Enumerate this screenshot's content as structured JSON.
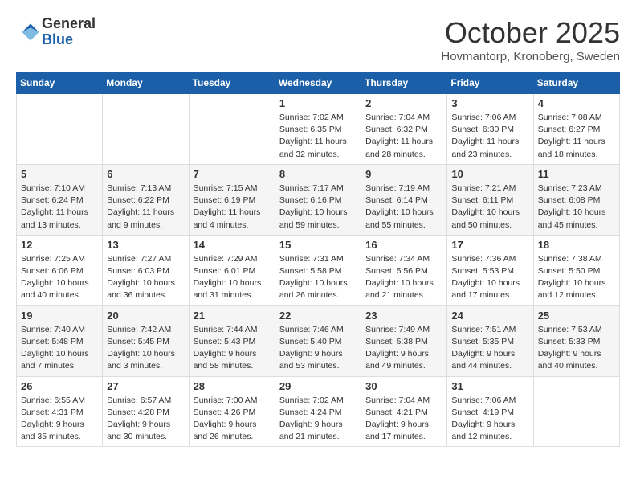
{
  "header": {
    "logo_general": "General",
    "logo_blue": "Blue",
    "month_title": "October 2025",
    "location": "Hovmantorp, Kronoberg, Sweden"
  },
  "weekdays": [
    "Sunday",
    "Monday",
    "Tuesday",
    "Wednesday",
    "Thursday",
    "Friday",
    "Saturday"
  ],
  "weeks": [
    [
      {
        "day": "",
        "info": ""
      },
      {
        "day": "",
        "info": ""
      },
      {
        "day": "",
        "info": ""
      },
      {
        "day": "1",
        "info": "Sunrise: 7:02 AM\nSunset: 6:35 PM\nDaylight: 11 hours\nand 32 minutes."
      },
      {
        "day": "2",
        "info": "Sunrise: 7:04 AM\nSunset: 6:32 PM\nDaylight: 11 hours\nand 28 minutes."
      },
      {
        "day": "3",
        "info": "Sunrise: 7:06 AM\nSunset: 6:30 PM\nDaylight: 11 hours\nand 23 minutes."
      },
      {
        "day": "4",
        "info": "Sunrise: 7:08 AM\nSunset: 6:27 PM\nDaylight: 11 hours\nand 18 minutes."
      }
    ],
    [
      {
        "day": "5",
        "info": "Sunrise: 7:10 AM\nSunset: 6:24 PM\nDaylight: 11 hours\nand 13 minutes."
      },
      {
        "day": "6",
        "info": "Sunrise: 7:13 AM\nSunset: 6:22 PM\nDaylight: 11 hours\nand 9 minutes."
      },
      {
        "day": "7",
        "info": "Sunrise: 7:15 AM\nSunset: 6:19 PM\nDaylight: 11 hours\nand 4 minutes."
      },
      {
        "day": "8",
        "info": "Sunrise: 7:17 AM\nSunset: 6:16 PM\nDaylight: 10 hours\nand 59 minutes."
      },
      {
        "day": "9",
        "info": "Sunrise: 7:19 AM\nSunset: 6:14 PM\nDaylight: 10 hours\nand 55 minutes."
      },
      {
        "day": "10",
        "info": "Sunrise: 7:21 AM\nSunset: 6:11 PM\nDaylight: 10 hours\nand 50 minutes."
      },
      {
        "day": "11",
        "info": "Sunrise: 7:23 AM\nSunset: 6:08 PM\nDaylight: 10 hours\nand 45 minutes."
      }
    ],
    [
      {
        "day": "12",
        "info": "Sunrise: 7:25 AM\nSunset: 6:06 PM\nDaylight: 10 hours\nand 40 minutes."
      },
      {
        "day": "13",
        "info": "Sunrise: 7:27 AM\nSunset: 6:03 PM\nDaylight: 10 hours\nand 36 minutes."
      },
      {
        "day": "14",
        "info": "Sunrise: 7:29 AM\nSunset: 6:01 PM\nDaylight: 10 hours\nand 31 minutes."
      },
      {
        "day": "15",
        "info": "Sunrise: 7:31 AM\nSunset: 5:58 PM\nDaylight: 10 hours\nand 26 minutes."
      },
      {
        "day": "16",
        "info": "Sunrise: 7:34 AM\nSunset: 5:56 PM\nDaylight: 10 hours\nand 21 minutes."
      },
      {
        "day": "17",
        "info": "Sunrise: 7:36 AM\nSunset: 5:53 PM\nDaylight: 10 hours\nand 17 minutes."
      },
      {
        "day": "18",
        "info": "Sunrise: 7:38 AM\nSunset: 5:50 PM\nDaylight: 10 hours\nand 12 minutes."
      }
    ],
    [
      {
        "day": "19",
        "info": "Sunrise: 7:40 AM\nSunset: 5:48 PM\nDaylight: 10 hours\nand 7 minutes."
      },
      {
        "day": "20",
        "info": "Sunrise: 7:42 AM\nSunset: 5:45 PM\nDaylight: 10 hours\nand 3 minutes."
      },
      {
        "day": "21",
        "info": "Sunrise: 7:44 AM\nSunset: 5:43 PM\nDaylight: 9 hours\nand 58 minutes."
      },
      {
        "day": "22",
        "info": "Sunrise: 7:46 AM\nSunset: 5:40 PM\nDaylight: 9 hours\nand 53 minutes."
      },
      {
        "day": "23",
        "info": "Sunrise: 7:49 AM\nSunset: 5:38 PM\nDaylight: 9 hours\nand 49 minutes."
      },
      {
        "day": "24",
        "info": "Sunrise: 7:51 AM\nSunset: 5:35 PM\nDaylight: 9 hours\nand 44 minutes."
      },
      {
        "day": "25",
        "info": "Sunrise: 7:53 AM\nSunset: 5:33 PM\nDaylight: 9 hours\nand 40 minutes."
      }
    ],
    [
      {
        "day": "26",
        "info": "Sunrise: 6:55 AM\nSunset: 4:31 PM\nDaylight: 9 hours\nand 35 minutes."
      },
      {
        "day": "27",
        "info": "Sunrise: 6:57 AM\nSunset: 4:28 PM\nDaylight: 9 hours\nand 30 minutes."
      },
      {
        "day": "28",
        "info": "Sunrise: 7:00 AM\nSunset: 4:26 PM\nDaylight: 9 hours\nand 26 minutes."
      },
      {
        "day": "29",
        "info": "Sunrise: 7:02 AM\nSunset: 4:24 PM\nDaylight: 9 hours\nand 21 minutes."
      },
      {
        "day": "30",
        "info": "Sunrise: 7:04 AM\nSunset: 4:21 PM\nDaylight: 9 hours\nand 17 minutes."
      },
      {
        "day": "31",
        "info": "Sunrise: 7:06 AM\nSunset: 4:19 PM\nDaylight: 9 hours\nand 12 minutes."
      },
      {
        "day": "",
        "info": ""
      }
    ]
  ]
}
